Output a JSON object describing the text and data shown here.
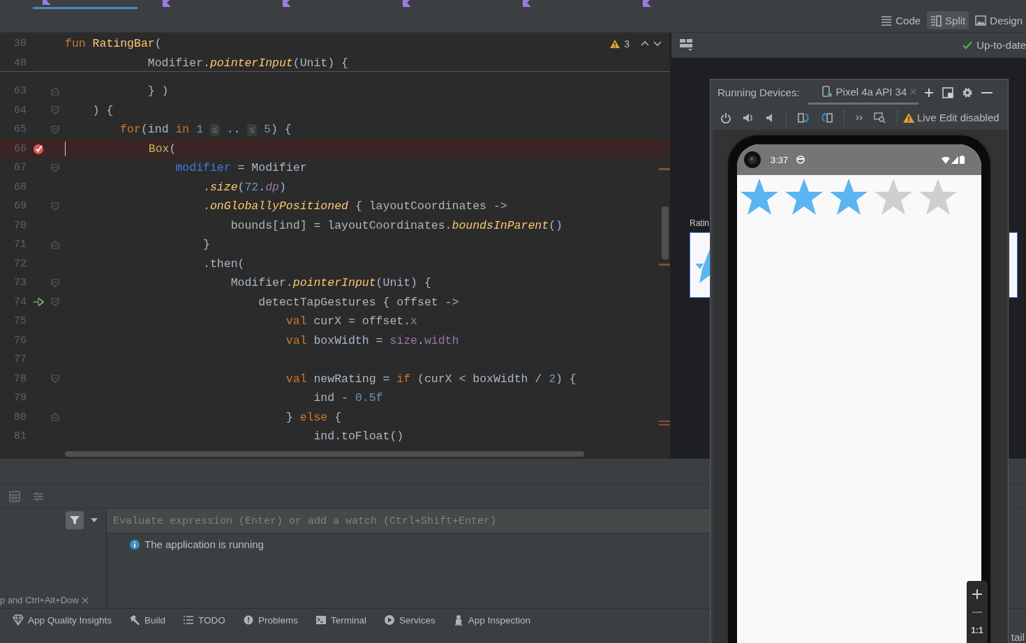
{
  "editor_tabs": [
    {
      "selected": true
    },
    {
      "selected": false
    },
    {
      "selected": false
    },
    {
      "selected": false
    },
    {
      "selected": false
    },
    {
      "selected": false
    }
  ],
  "view_modes": [
    {
      "label": "Code",
      "kind": "code",
      "selected": false
    },
    {
      "label": "Split",
      "kind": "split",
      "selected": true
    },
    {
      "label": "Design",
      "kind": "design",
      "selected": false
    }
  ],
  "editor": {
    "warnings": "3",
    "sticky_lines": [
      {
        "number": "38",
        "parts": [
          {
            "kind": "kw",
            "t": "fun "
          },
          {
            "kind": "fn",
            "t": "RatingBar"
          },
          {
            "kind": "p",
            "t": "("
          }
        ]
      },
      {
        "number": "48",
        "parts": [
          {
            "kind": "p",
            "t": "            Modifier."
          },
          {
            "kind": "ext",
            "t": "pointerInput"
          },
          {
            "kind": "p",
            "t": "(Unit) {"
          }
        ]
      }
    ],
    "lines": [
      {
        "number": "63",
        "fold": {
          "kind": "end"
        },
        "parts": [
          {
            "kind": "p",
            "t": "            } )"
          }
        ]
      },
      {
        "number": "64",
        "fold": {
          "kind": "start"
        },
        "parts": [
          {
            "kind": "p",
            "t": "    ) {"
          }
        ]
      },
      {
        "number": "65",
        "fold": {
          "kind": "start"
        },
        "parts": [
          {
            "kind": "kw",
            "t": "        for"
          },
          {
            "kind": "p",
            "t": "(ind "
          },
          {
            "kind": "kw",
            "t": "in"
          },
          {
            "kind": "num",
            "t": " 1 "
          },
          {
            "kind": "hint",
            "t": "≤"
          },
          {
            "kind": "p",
            "t": " .. "
          },
          {
            "kind": "hint",
            "t": "≤"
          },
          {
            "kind": "num",
            "t": " 5"
          },
          {
            "kind": "p",
            "t": ") {"
          }
        ]
      },
      {
        "number": "66",
        "marker": {
          "kind": "breakpoint"
        },
        "parts": [
          {
            "kind": "call",
            "t": "            Box"
          },
          {
            "kind": "p",
            "t": "("
          }
        ]
      },
      {
        "number": "67",
        "fold": {
          "kind": "start"
        },
        "parts": [
          {
            "kind": "named",
            "t": "                modifier"
          },
          {
            "kind": "p",
            "t": " = Modifier"
          }
        ]
      },
      {
        "number": "68",
        "parts": [
          {
            "kind": "p",
            "t": "                    ."
          },
          {
            "kind": "ext",
            "t": "size"
          },
          {
            "kind": "p",
            "t": "("
          },
          {
            "kind": "num",
            "t": "72"
          },
          {
            "kind": "p",
            "t": "."
          },
          {
            "kind": "extprop",
            "t": "dp"
          },
          {
            "kind": "p",
            "t": ")"
          }
        ]
      },
      {
        "number": "69",
        "fold": {
          "kind": "start"
        },
        "parts": [
          {
            "kind": "p",
            "t": "                    ."
          },
          {
            "kind": "ext",
            "t": "onGloballyPositioned"
          },
          {
            "kind": "p",
            "t": " { layoutCoordinates ->"
          }
        ]
      },
      {
        "number": "70",
        "parts": [
          {
            "kind": "p",
            "t": "                        bounds[ind] = layoutCoordinates."
          },
          {
            "kind": "ext",
            "t": "boundsInParent"
          },
          {
            "kind": "p",
            "t": "()"
          }
        ]
      },
      {
        "number": "71",
        "fold": {
          "kind": "end"
        },
        "parts": [
          {
            "kind": "p",
            "t": "                    }"
          }
        ]
      },
      {
        "number": "72",
        "parts": [
          {
            "kind": "p",
            "t": "                    .then("
          }
        ]
      },
      {
        "number": "73",
        "fold": {
          "kind": "start"
        },
        "parts": [
          {
            "kind": "p",
            "t": "                        Modifier."
          },
          {
            "kind": "ext",
            "t": "pointerInput"
          },
          {
            "kind": "p",
            "t": "(Unit) {"
          }
        ]
      },
      {
        "number": "74",
        "marker": {
          "kind": "lambda"
        },
        "fold": {
          "kind": "start"
        },
        "parts": [
          {
            "kind": "p",
            "t": "                            detectTapGestures { offset ->"
          }
        ]
      },
      {
        "number": "75",
        "parts": [
          {
            "kind": "kw",
            "t": "                                val"
          },
          {
            "kind": "p",
            "t": " curX = offset."
          },
          {
            "kind": "prop",
            "t": "x"
          }
        ]
      },
      {
        "number": "76",
        "parts": [
          {
            "kind": "kw",
            "t": "                                val"
          },
          {
            "kind": "p",
            "t": " boxWidth = "
          },
          {
            "kind": "prop",
            "t": "size"
          },
          {
            "kind": "p",
            "t": "."
          },
          {
            "kind": "prop",
            "t": "width"
          }
        ]
      },
      {
        "number": "77"
      },
      {
        "number": "78",
        "fold": {
          "kind": "start"
        },
        "parts": [
          {
            "kind": "kw",
            "t": "                                val"
          },
          {
            "kind": "p",
            "t": " newRating = "
          },
          {
            "kind": "kw",
            "t": "if"
          },
          {
            "kind": "p",
            "t": " (curX < boxWidth / "
          },
          {
            "kind": "num",
            "t": "2"
          },
          {
            "kind": "p",
            "t": ") {"
          }
        ]
      },
      {
        "number": "79",
        "parts": [
          {
            "kind": "p",
            "t": "                                    ind - "
          },
          {
            "kind": "num",
            "t": "0.5f"
          }
        ]
      },
      {
        "number": "80",
        "fold": {
          "kind": "end"
        },
        "parts": [
          {
            "kind": "p",
            "t": "                                } "
          },
          {
            "kind": "kw",
            "t": "else"
          },
          {
            "kind": "p",
            "t": " {"
          }
        ]
      },
      {
        "number": "81",
        "parts": [
          {
            "kind": "p",
            "t": "                                    ind.toFloat()"
          }
        ]
      }
    ]
  },
  "preview": {
    "status": "Up-to-date",
    "component_label": "Ratin"
  },
  "running_devices": {
    "title": "Running Devices:",
    "device_tab": "Pixel 4a API 34",
    "live_edit": "Live Edit disabled",
    "phone": {
      "time": "3:37",
      "rating": {
        "stars": 3
      }
    },
    "zoom_reset": "1:1"
  },
  "debugger": {
    "frames_hint": "p and Ctrl+Alt+Dow",
    "evaluate": {
      "placeholder": "Evaluate expression (Enter) or add a watch (Ctrl+Shift+Enter)"
    },
    "message": "The application is running"
  },
  "tool_windows": [
    {
      "label": "App Quality Insights",
      "kind": "diamond"
    },
    {
      "label": "Build",
      "kind": "hammer"
    },
    {
      "label": "TODO",
      "kind": "list"
    },
    {
      "label": "Problems",
      "kind": "problems"
    },
    {
      "label": "Terminal",
      "kind": "terminal"
    },
    {
      "label": "Services",
      "kind": "services"
    },
    {
      "label": "App Inspection",
      "kind": "inspection"
    }
  ],
  "side_label": "tail"
}
